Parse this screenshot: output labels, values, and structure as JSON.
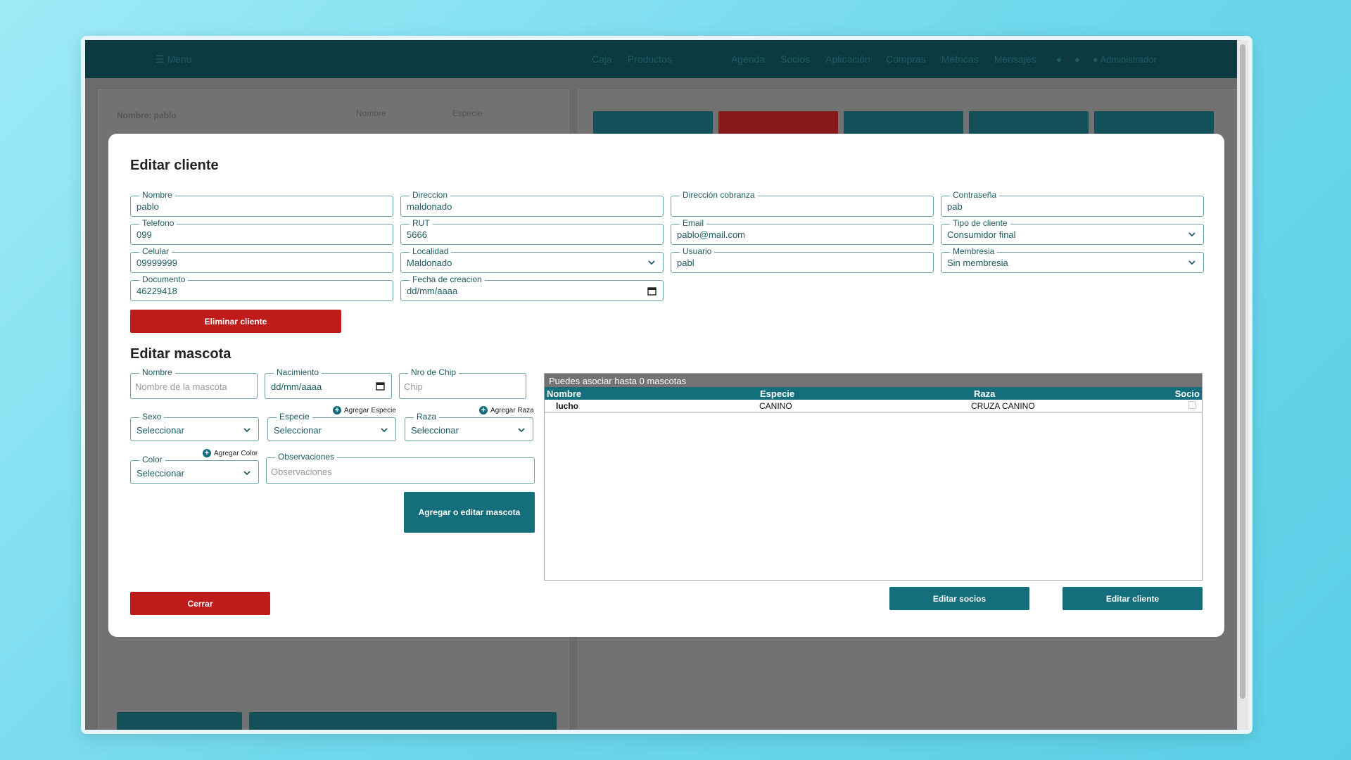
{
  "background_app": {
    "menu_label": "Menu",
    "nav_items": [
      "Caja",
      "Productos",
      "",
      "Agenda",
      "Socios",
      "Aplicación",
      "Compras",
      "Métricas",
      "Mensajes"
    ],
    "user_label": "Administrador",
    "filter_label": "Nombre: pablo",
    "col_nombre": "Nombre",
    "col_especie": "Especie"
  },
  "client_section": {
    "title": "Editar cliente",
    "fields": {
      "nombre": {
        "label": "Nombre",
        "value": "pablo"
      },
      "direccion": {
        "label": "Direccion",
        "value": "maldonado"
      },
      "direccion_cobranza": {
        "label": "Dirección cobranza",
        "value": ""
      },
      "contrasena": {
        "label": "Contraseña",
        "value": "pab"
      },
      "telefono": {
        "label": "Telefono",
        "value": "099"
      },
      "rut": {
        "label": "RUT",
        "value": "5666"
      },
      "email": {
        "label": "Email",
        "value": "pablo@mail.com"
      },
      "tipo_cliente": {
        "label": "Tipo de cliente",
        "value": "Consumidor final"
      },
      "celular": {
        "label": "Celular",
        "value": "09999999"
      },
      "localidad": {
        "label": "Localidad",
        "value": "Maldonado"
      },
      "usuario": {
        "label": "Usuario",
        "value": "pabl"
      },
      "membresia": {
        "label": "Membresia",
        "value": "Sin membresia"
      },
      "documento": {
        "label": "Documento",
        "value": "46229418"
      },
      "fecha_creacion": {
        "label": "Fecha de creacion",
        "value": "dd/mm/aaaa"
      }
    },
    "delete_button": "Eliminar cliente"
  },
  "pet_section": {
    "title": "Editar mascota",
    "fields": {
      "nombre": {
        "label": "Nombre",
        "placeholder": "Nombre de la mascota"
      },
      "nacimiento": {
        "label": "Nacimiento",
        "value": "dd/mm/aaaa"
      },
      "chip": {
        "label": "Nro de Chip",
        "placeholder": "Chip"
      },
      "sexo": {
        "label": "Sexo",
        "value": "Seleccionar"
      },
      "especie": {
        "label": "Especie",
        "value": "Seleccionar"
      },
      "raza": {
        "label": "Raza",
        "value": "Seleccionar"
      },
      "color": {
        "label": "Color",
        "value": "Seleccionar"
      },
      "observaciones": {
        "label": "Observaciones",
        "placeholder": "Observaciones"
      }
    },
    "add_especie": "Agregar Especie",
    "add_raza": "Agregar Raza",
    "add_color": "Agregar Color",
    "save_button": "Agregar o editar mascota"
  },
  "pets_table": {
    "caption": "Puedes asociar hasta 0 mascotas",
    "headers": {
      "nombre": "Nombre",
      "especie": "Especie",
      "raza": "Raza",
      "socio": "Socio"
    },
    "rows": [
      {
        "nombre": "lucho",
        "especie": "CANINO",
        "raza": "CRUZA CANINO",
        "socio": false
      }
    ]
  },
  "footer": {
    "close_button": "Cerrar",
    "edit_socios_button": "Editar socios",
    "edit_cliente_button": "Editar cliente"
  },
  "colors": {
    "accent": "#146e7c",
    "danger": "#c01b1b",
    "topbar": "#0c3a40"
  }
}
